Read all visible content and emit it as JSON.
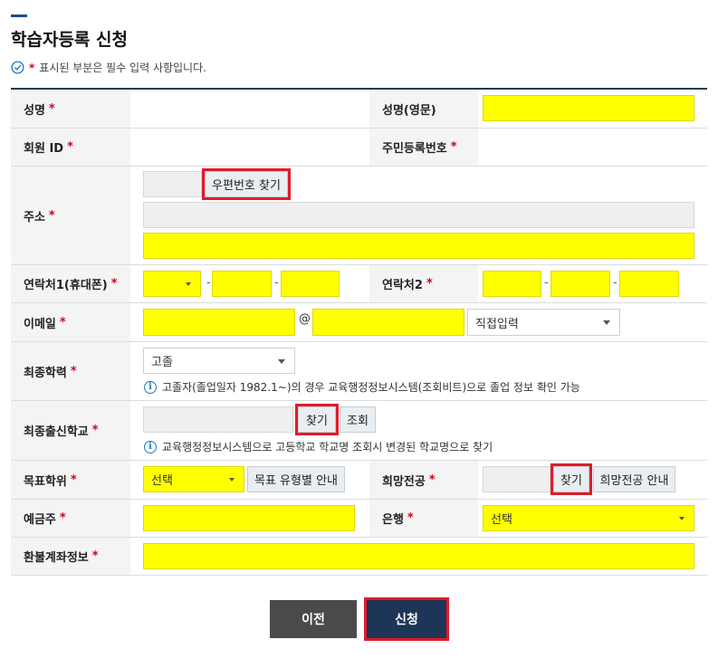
{
  "page": {
    "title": "학습자등록 신청",
    "notice_star": "*",
    "notice": "표시된 부분은 필수 입력 사항입니다."
  },
  "form": {
    "required_mark": "*",
    "name_label": "성명",
    "name_en_label": "성명(영문)",
    "member_id_label": "회원 ID",
    "resident_no_label": "주민등록번호",
    "address_label": "주소",
    "zip_button": "우편번호 찾기",
    "phone1_label": "연락처1(휴대폰)",
    "phone2_label": "연락처2",
    "dash": "-",
    "email_label": "이메일",
    "at_sign": "@",
    "email_domain_select": "직접입력",
    "education_label": "최종학력",
    "education_select": "고졸",
    "education_info": "고졸자(졸업일자 1982.1~)의 경우 교육행정정보시스템(조회비트)으로 졸업 정보 확인 가능",
    "school_label": "최종출신학교",
    "find_button": "찾기",
    "lookup_button": "조회",
    "school_info": "교육행정정보시스템으로 고등학교 학교명 조회시 변경된 학교명으로 찾기",
    "degree_label": "목표학위",
    "degree_select": "선택",
    "degree_guide_button": "목표 유형별 안내",
    "major_label": "희망전공",
    "major_find_button": "찾기",
    "major_guide_button": "희망전공 안내",
    "depositor_label": "예금주",
    "bank_label": "은행",
    "bank_select": "선택",
    "refund_label": "환불계좌정보"
  },
  "buttons": {
    "prev": "이전",
    "submit": "신청"
  },
  "colors": {
    "accent_navy": "#1f3a5a",
    "submit_bg": "#1d3557",
    "prev_bg": "#4a4a4a",
    "highlight_yellow": "#ffff00",
    "required_red": "#d0021b",
    "annotation_red": "#e11b2a"
  },
  "icons": {
    "notice": "check-circle-icon",
    "info": "info-icon",
    "dropdown": "chevron-down-icon"
  }
}
